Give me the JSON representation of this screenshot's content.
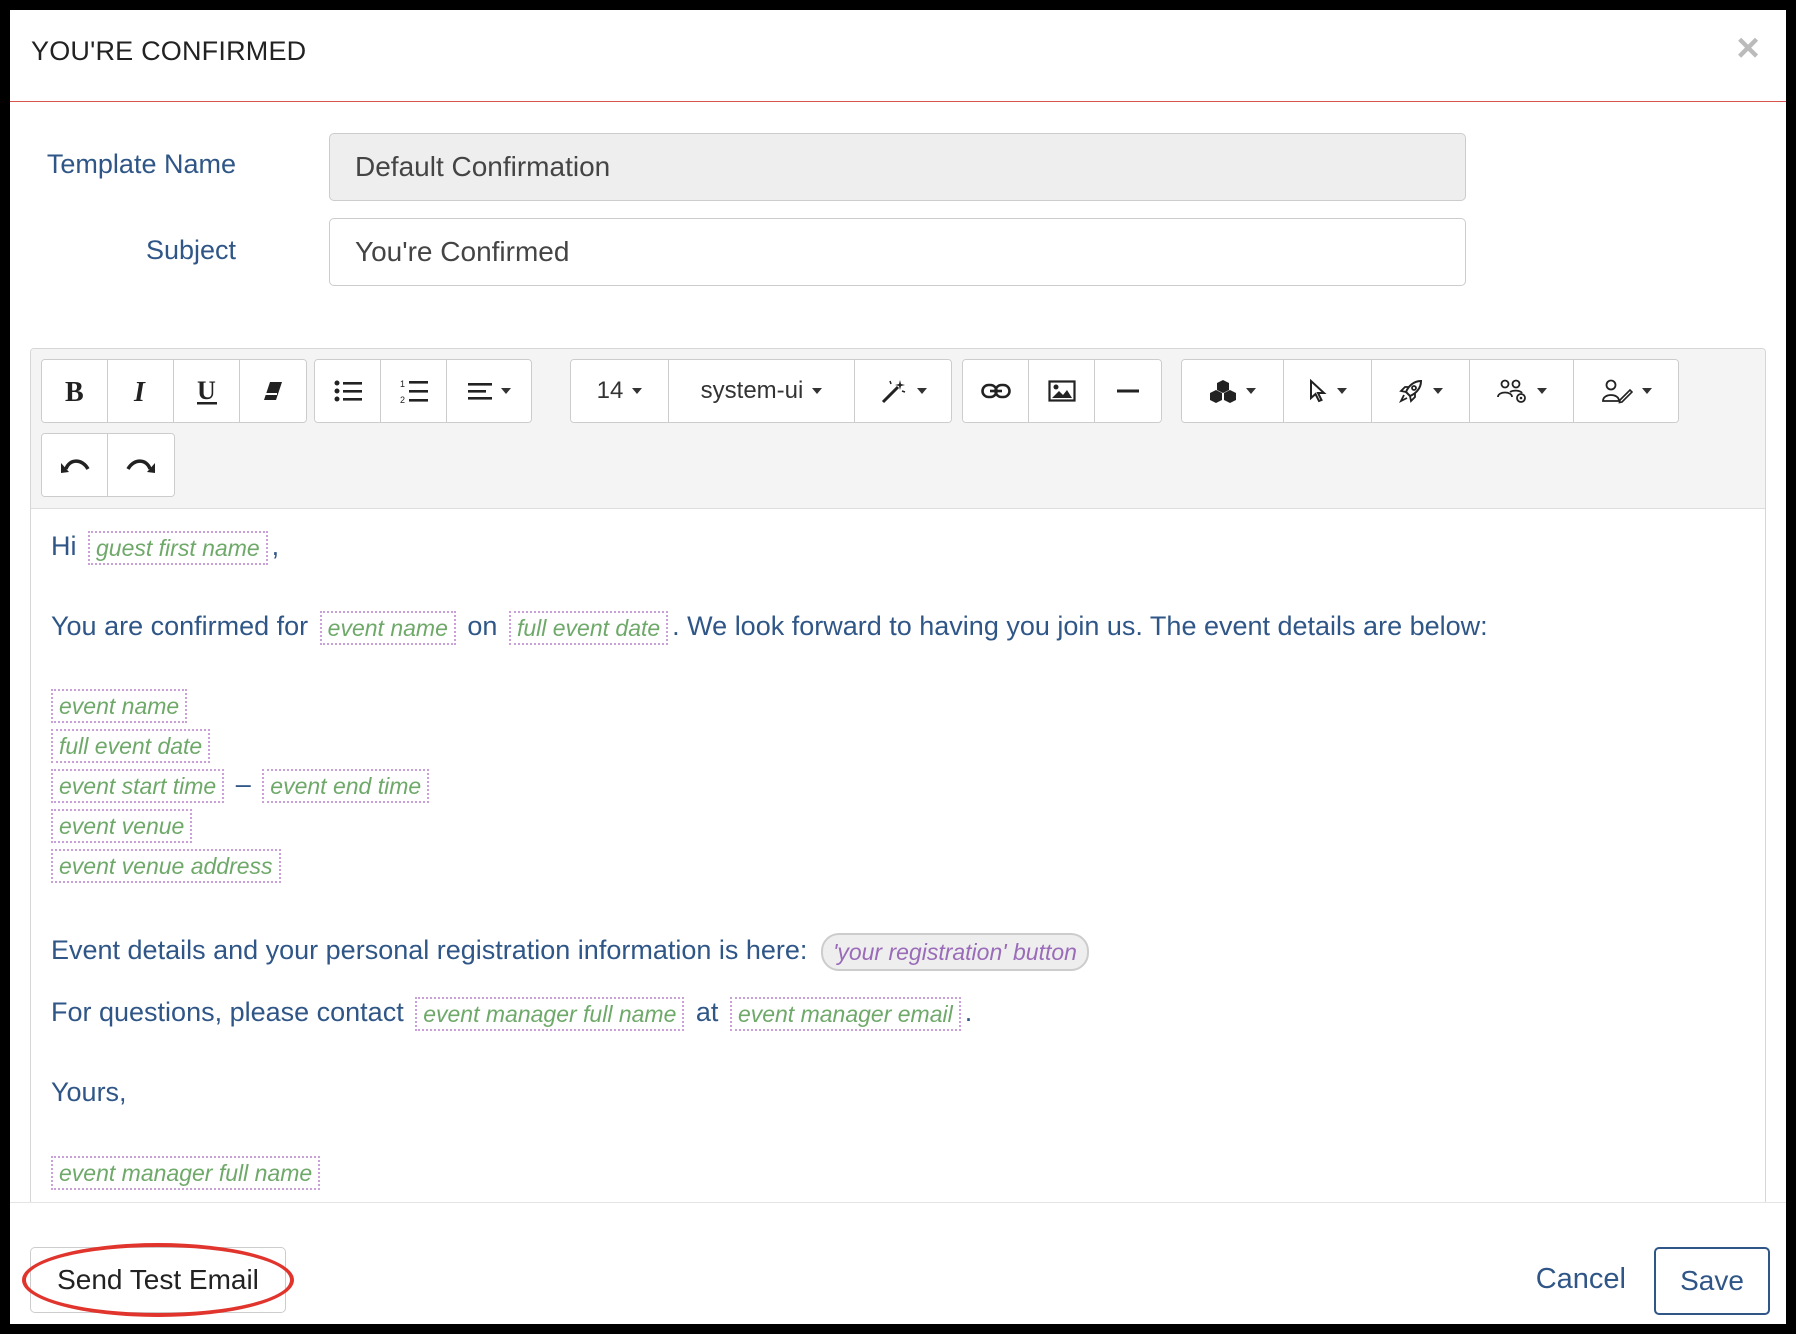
{
  "modal": {
    "title": "YOU'RE CONFIRMED",
    "close_icon": "×"
  },
  "form": {
    "template_name_label": "Template Name",
    "template_name_value": "Default Confirmation",
    "subject_label": "Subject",
    "subject_value": "You're Confirmed"
  },
  "toolbar": {
    "font_size": "14",
    "font_family": "system-ui",
    "icons": [
      "bold-icon",
      "italic-icon",
      "underline-icon",
      "eraser-icon",
      "bullet-list-icon",
      "numbered-list-icon",
      "align-icon",
      "magic-wand-icon",
      "link-icon",
      "image-icon",
      "horizontal-rule-icon",
      "blocks-icon",
      "cursor-icon",
      "rocket-icon",
      "users-gear-icon",
      "user-edit-icon",
      "undo-icon",
      "redo-icon"
    ]
  },
  "content": {
    "greeting": "Hi",
    "comma": ",",
    "line1_a": "You are confirmed for",
    "line1_on": "on",
    "line1_b": ". We look forward to having you join us. The event details are below:",
    "dash": "–",
    "details_text": "Event details and your personal registration information is here:",
    "questions_a": "For questions, please contact",
    "questions_at": "at",
    "period": ".",
    "signoff": "Yours,",
    "tags": {
      "guest_first_name": "guest first name",
      "event_name": "event name",
      "full_event_date": "full event date",
      "event_start_time": "event start time",
      "event_end_time": "event end time",
      "event_venue": "event venue",
      "event_venue_address": "event venue address",
      "your_registration_button": "'your registration' button",
      "event_manager_full_name": "event manager full name",
      "event_manager_email": "event manager email"
    }
  },
  "footer": {
    "send_test_label": "Send Test Email",
    "cancel_label": "Cancel",
    "save_label": "Save"
  },
  "colors": {
    "label_blue": "#2f5687",
    "tag_green": "#6fa96a",
    "tag_border": "#c9a0d8",
    "highlight_red": "#e0342c",
    "header_rule": "#d9534f"
  }
}
